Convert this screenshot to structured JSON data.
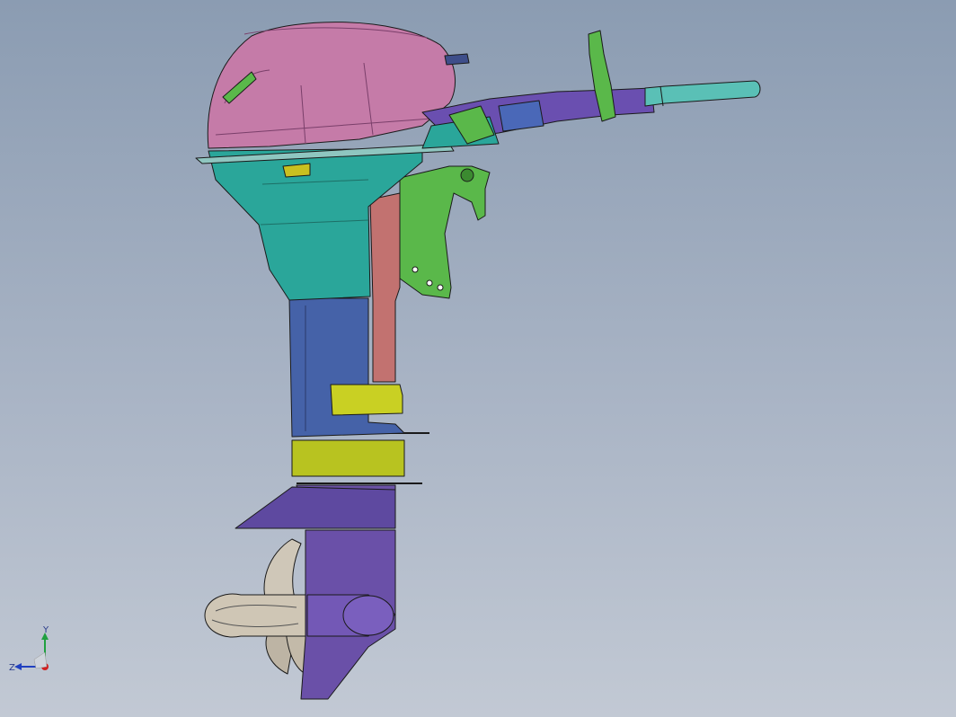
{
  "viewport": {
    "background_top": "#8b9cb2",
    "background_bottom": "#c2c9d4"
  },
  "model": {
    "parts": [
      "engine-cowling",
      "cowling-lower-pan",
      "tiller-arm",
      "tiller-grip",
      "shift-lever",
      "clamp-bracket",
      "swivel-bracket",
      "steering-shaft",
      "midsection-housing",
      "mount-yellow",
      "anti-ventilation-plate",
      "lower-unit",
      "gearcase-torpedo",
      "propeller"
    ],
    "colors": {
      "cowling": "#c97aa8",
      "lower_cowl": "#2aa89a",
      "midsection": "#4563a8",
      "lower_unit": "#6a4fa6",
      "bracket_green": "#5ab94a",
      "bracket_red": "#c8746e",
      "yellow": "#c8d021",
      "grip": "#5bc2b8",
      "propeller": "#c8bfb0"
    }
  },
  "triad": {
    "y_label": "Y",
    "z_label": "Z",
    "x_color": "#d22020",
    "y_color": "#20a040",
    "z_color": "#2040c0"
  }
}
